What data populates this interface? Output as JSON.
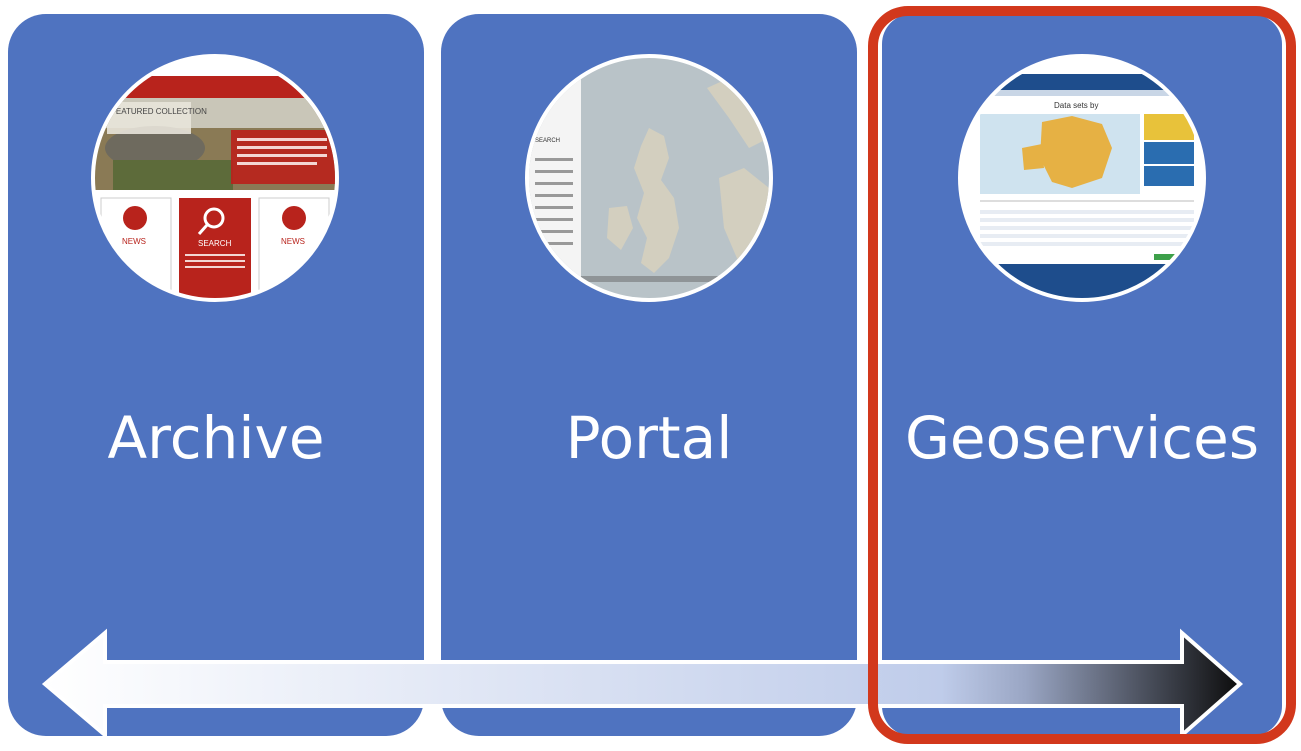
{
  "panels": [
    {
      "label": "Archive",
      "thumbnail": "archive-website-screenshot",
      "highlighted": false
    },
    {
      "label": "Portal",
      "thumbnail": "map-portal-screenshot",
      "highlighted": false
    },
    {
      "label": "Geoservices",
      "thumbnail": "geoportal-europe-map-screenshot",
      "highlighted": true
    }
  ],
  "thumb_text": {
    "featured": "FEATURED COLLECTION",
    "news": "NEWS",
    "search": "SEARCH",
    "portal_search": "SEARCH",
    "geo_title": "Data sets by"
  },
  "colors": {
    "panel": "#4f73c0",
    "highlight": "#d2381c",
    "arrow_light": "#ffffff",
    "arrow_dark": "#111111"
  },
  "icons": [
    "double-headed-arrow-icon",
    "search-icon"
  ]
}
